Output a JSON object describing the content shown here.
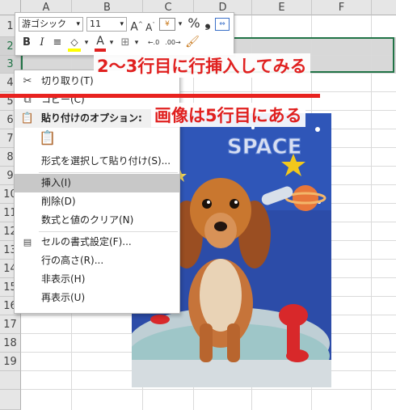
{
  "columns": [
    "A",
    "B",
    "C",
    "D",
    "E",
    "F"
  ],
  "rows": [
    "1",
    "2",
    "3",
    "4",
    "5",
    "6",
    "7",
    "8",
    "9",
    "10",
    "11",
    "12",
    "13",
    "14",
    "15",
    "16",
    "17",
    "18",
    "19"
  ],
  "mini_toolbar": {
    "font_name": "游ゴシック",
    "font_size": "11",
    "grow_font": "A",
    "shrink_font": "A",
    "percent": "%",
    "comma": "❟",
    "bold": "B",
    "italic": "I",
    "font_color_letter": "A"
  },
  "context_menu": {
    "items": [
      {
        "label": "切り取り(T)",
        "icon": "scissors-icon"
      },
      {
        "label": "コピー(C)",
        "icon": "copy-icon"
      },
      {
        "label": "貼り付けのオプション:",
        "icon": "paste-icon"
      },
      {
        "label": "形式を選択して貼り付け(S)...",
        "icon": ""
      },
      {
        "label": "挿入(I)",
        "icon": "",
        "highlighted": true
      },
      {
        "label": "削除(D)",
        "icon": ""
      },
      {
        "label": "数式と値のクリア(N)",
        "icon": ""
      },
      {
        "label": "セルの書式設定(F)...",
        "icon": "format-cells-icon"
      },
      {
        "label": "行の高さ(R)...",
        "icon": ""
      },
      {
        "label": "非表示(H)",
        "icon": ""
      },
      {
        "label": "再表示(U)",
        "icon": ""
      }
    ]
  },
  "annotations": {
    "line1": "2～3行目に行挿入してみる",
    "line2": "画像は5行目にある"
  },
  "photo": {
    "banner_text": "SPACE"
  },
  "colors": {
    "annotation_red": "#e0201f",
    "selection_green": "#217346"
  }
}
